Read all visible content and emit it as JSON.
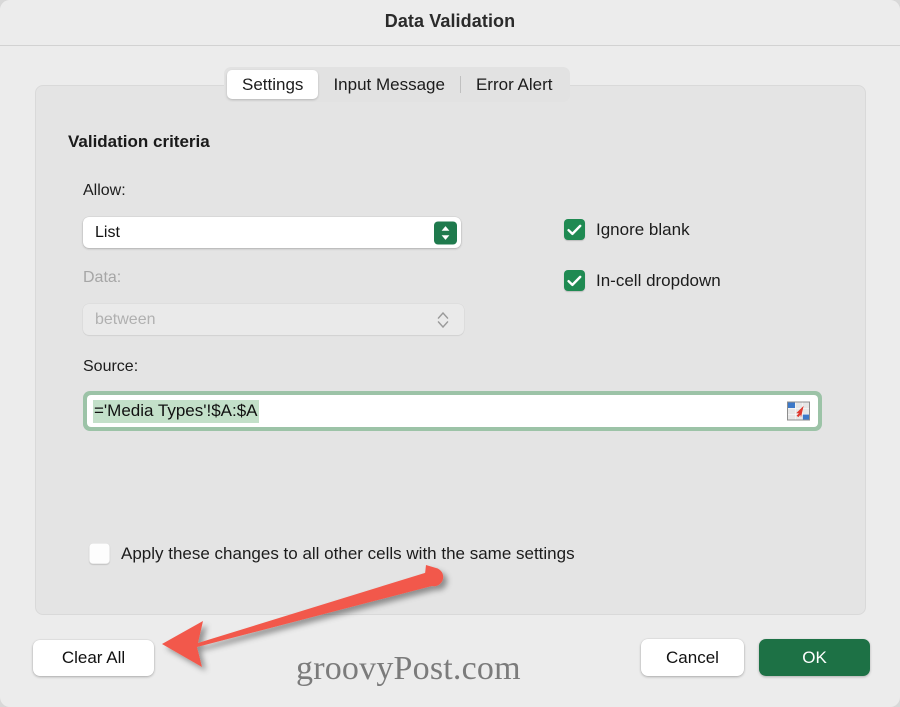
{
  "dialog": {
    "title": "Data Validation"
  },
  "tabs": [
    {
      "label": "Settings",
      "active": true
    },
    {
      "label": "Input Message",
      "active": false
    },
    {
      "label": "Error Alert",
      "active": false
    }
  ],
  "criteria": {
    "heading": "Validation criteria",
    "allow": {
      "label": "Allow:",
      "value": "List",
      "stepper_icon": "chevron-up-down-icon"
    },
    "data": {
      "label": "Data:",
      "value": "between",
      "disabled": true,
      "stepper_icon": "chevron-up-down-icon"
    },
    "source": {
      "label": "Source:",
      "value": "='Media Types'!$A:$A",
      "picker_icon": "range-select-icon"
    }
  },
  "options": [
    {
      "label": "Ignore blank",
      "checked": true
    },
    {
      "label": "In-cell dropdown",
      "checked": true
    }
  ],
  "apply_all": {
    "label": "Apply these changes to all other cells with the same settings",
    "checked": false
  },
  "buttons": {
    "clear_all": "Clear All",
    "cancel": "Cancel",
    "ok": "OK"
  },
  "watermark": "groovyPost.com",
  "annotation": {
    "type": "arrow",
    "color": "#F2594B",
    "points_to": "clear-all-button"
  },
  "colors": {
    "accent_green": "#1d7145",
    "check_green": "#1f8a52",
    "focus_ring": "#9cc3a7",
    "selection": "#c3e0c9",
    "dialog_bg": "#ececec",
    "panel_bg": "#e4e4e4"
  }
}
